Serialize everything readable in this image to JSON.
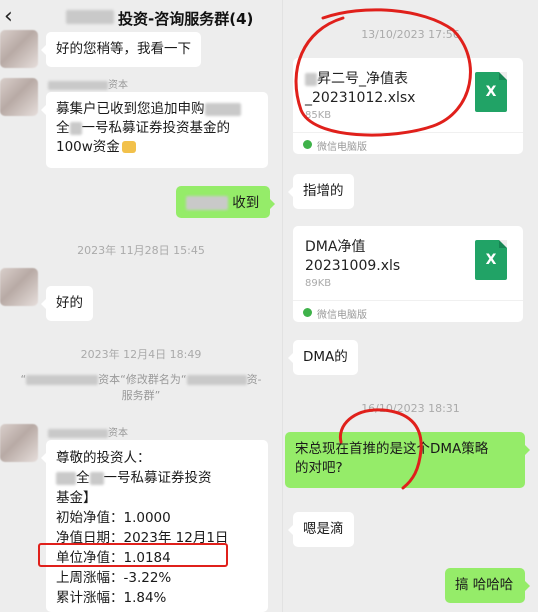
{
  "left": {
    "header": {
      "back_icon": "chevron-left-icon",
      "title": "投资-咨询服务群(4)"
    },
    "messages": {
      "m1": "好的您稍等，我看一下",
      "m2_sender": "资本",
      "m2_l1": "募集户已收到您追加申购",
      "m2_l2": "全",
      "m2_l2b": "一号私募证券投资基金的",
      "m2_l3": "100w资金",
      "m3": "收到",
      "t1": "2023年 11月28日 15:45",
      "m4": "好的",
      "t2": "2023年 12月4日 18:49",
      "sys_a": "“",
      "sys_b": "资本“修改群名为“",
      "sys_c": "资-",
      "sys_d": "服务群”",
      "m5_sender": "资本",
      "m5_l1": "尊敬的投资人：",
      "m5_l2a": "全",
      "m5_l2b": "一号私募证券投资",
      "m5_l3": "基金】",
      "m5_l4": "初始净值：1.0000",
      "m5_l5": "净值日期：2023年 12月1日",
      "m5_l6": "单位净值：1.0184",
      "m5_l7": "上周涨幅：-3.22%",
      "m5_l8": "累计涨幅：1.84%"
    }
  },
  "right": {
    "time1": "13/10/2023 17:56",
    "file1": {
      "name_l1": "昇二号_净值表",
      "name_l2": "_20231012.xlsx",
      "size": "85KB",
      "source": "微信电脑版",
      "icon": "excel-icon",
      "icon_letter": "X"
    },
    "r_msg1": "指增的",
    "file2": {
      "name_l1": "DMA净值",
      "name_l2": "20231009.xls",
      "size": "89KB",
      "source": "微信电脑版",
      "icon": "excel-icon",
      "icon_letter": "X"
    },
    "r_msg2": "DMA的",
    "time2": "16/10/2023 18:31",
    "r_msg3_l1": "宋总现在首推的是这个DMA策略",
    "r_msg3_l2": "的对吧?",
    "r_msg4": "嗯是滴",
    "r_msg5": "搞 哈哈哈"
  },
  "colors": {
    "background": "#ededed",
    "bubble_self": "#95ec69",
    "bubble_other": "#ffffff",
    "annotation_red": "#e0201b",
    "excel_green": "#21a366"
  }
}
